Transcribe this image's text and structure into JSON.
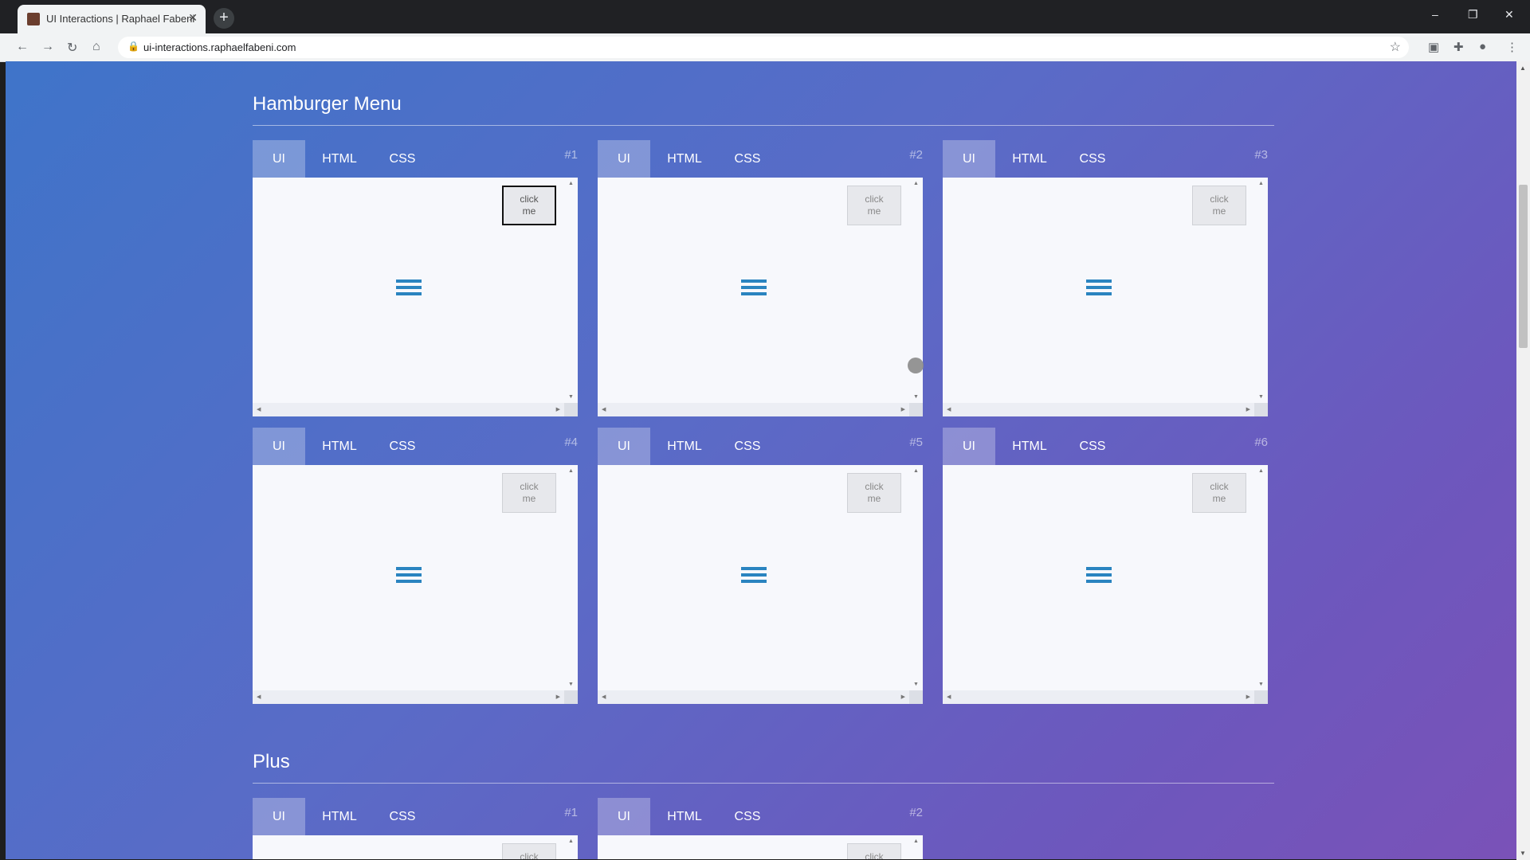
{
  "browser": {
    "tab_title": "UI Interactions | Raphael Fabeni",
    "tab_close": "✕",
    "new_tab": "+",
    "url": "ui-interactions.raphaelfabeni.com",
    "window_controls": {
      "minimize": "–",
      "restore": "❐",
      "close": "✕"
    }
  },
  "sections": [
    {
      "title": "Hamburger Menu"
    },
    {
      "title": "Plus"
    }
  ],
  "tab_labels": {
    "ui": "UI",
    "html": "HTML",
    "css": "CSS"
  },
  "cards": [
    {
      "num": "#1",
      "button": "click me"
    },
    {
      "num": "#2",
      "button": "click me"
    },
    {
      "num": "#3",
      "button": "click me"
    },
    {
      "num": "#4",
      "button": "click me"
    },
    {
      "num": "#5",
      "button": "click me"
    },
    {
      "num": "#6",
      "button": "click me"
    }
  ],
  "plus_cards": [
    {
      "num": "#1",
      "button": "click"
    },
    {
      "num": "#2",
      "button": "click"
    }
  ],
  "colors": {
    "accent": "#2a84c0",
    "bg_start": "#3f74c9",
    "bg_end": "#7a52b8"
  },
  "icons": [
    "back-icon",
    "forward-icon",
    "reload-icon",
    "home-icon",
    "lock-icon",
    "star-icon",
    "extensions-icon",
    "profile-icon",
    "menu-icon",
    "hamburger-icon"
  ]
}
